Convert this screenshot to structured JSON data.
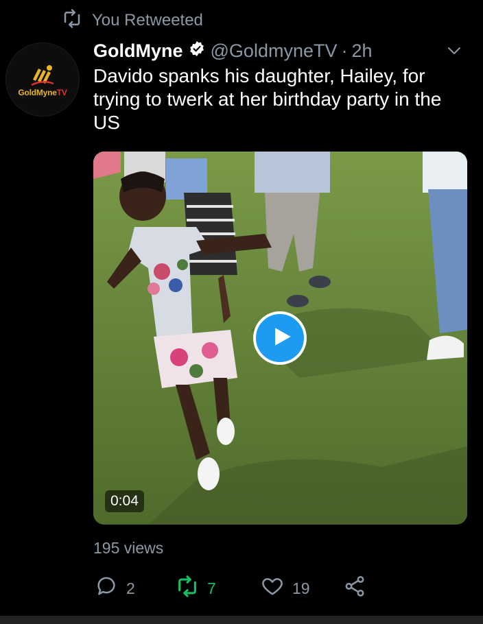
{
  "retweet_banner": {
    "label": "You Retweeted",
    "icon": "retweet-icon"
  },
  "tweet": {
    "author": {
      "name": "GoldMyne",
      "handle": "@GoldmyneTV",
      "verified": true,
      "avatar_text_main": "GoldMyne",
      "avatar_text_accent": "TV"
    },
    "separator": "·",
    "time": "2h",
    "text": "Davido spanks his daughter, Hailey, for trying to twerk at her birthday party in the US",
    "media": {
      "type": "video",
      "duration": "0:04",
      "play_icon": "play-icon"
    },
    "views": "195 views",
    "actions": {
      "reply_count": "2",
      "retweet_count": "7",
      "like_count": "19"
    }
  },
  "colors": {
    "background": "#000000",
    "muted": "#8b98a5",
    "accent": "#1d9bf0",
    "retweet_green": "#17bf63"
  }
}
